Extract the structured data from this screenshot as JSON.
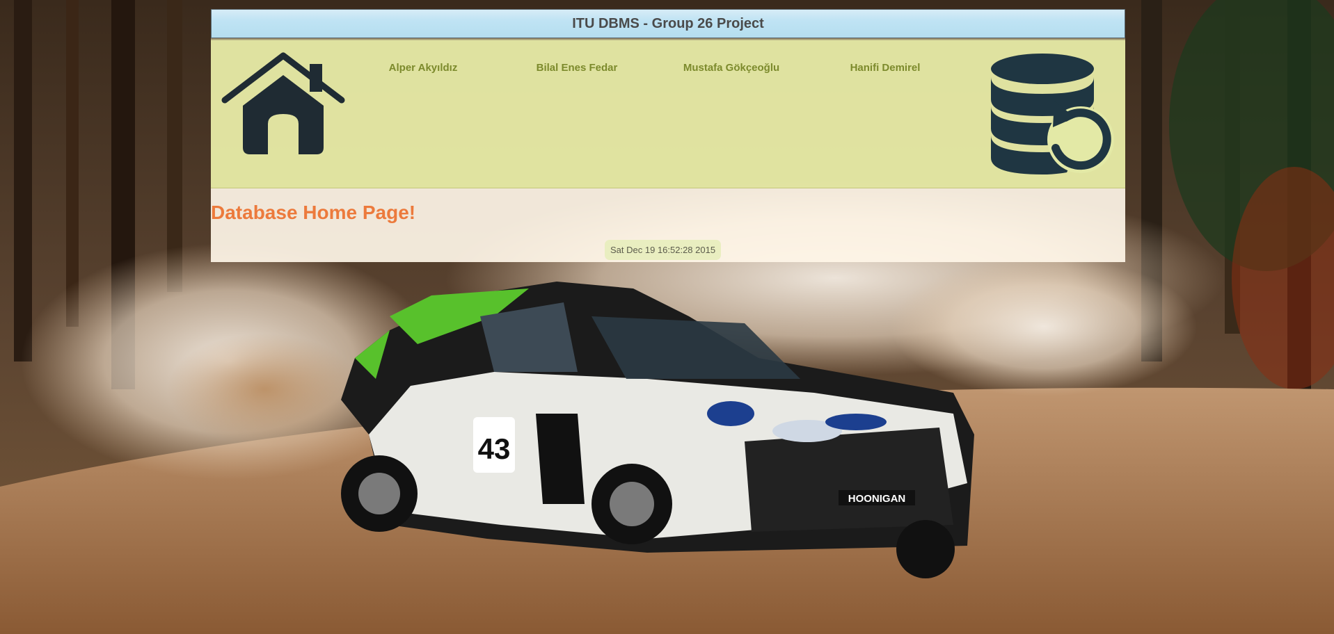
{
  "header": {
    "title": "ITU DBMS - Group 26 Project"
  },
  "nav": {
    "home_icon": "house-icon",
    "members": [
      {
        "label": "Alper Akyıldız"
      },
      {
        "label": "Bilal Enes Fedar"
      },
      {
        "label": "Mustafa Gökçeoğlu"
      },
      {
        "label": "Hanifi Demirel"
      }
    ],
    "db_icon": "database-restore-icon"
  },
  "main": {
    "heading": "Database Home Page!",
    "date": "Sat Dec 19 16:52:28 2015"
  },
  "background": {
    "subject": "rally car on dirt forest road",
    "car_number": "43",
    "sponsor_plate": "HOONIGAN"
  },
  "colors": {
    "title_bar": "#bfe3f4",
    "nav_panel": "#ecf0aa",
    "nav_link": "#7c8a2c",
    "heading": "#ec7a3c",
    "content_panel": "#fff6e8",
    "icon": "#1f2b33"
  }
}
